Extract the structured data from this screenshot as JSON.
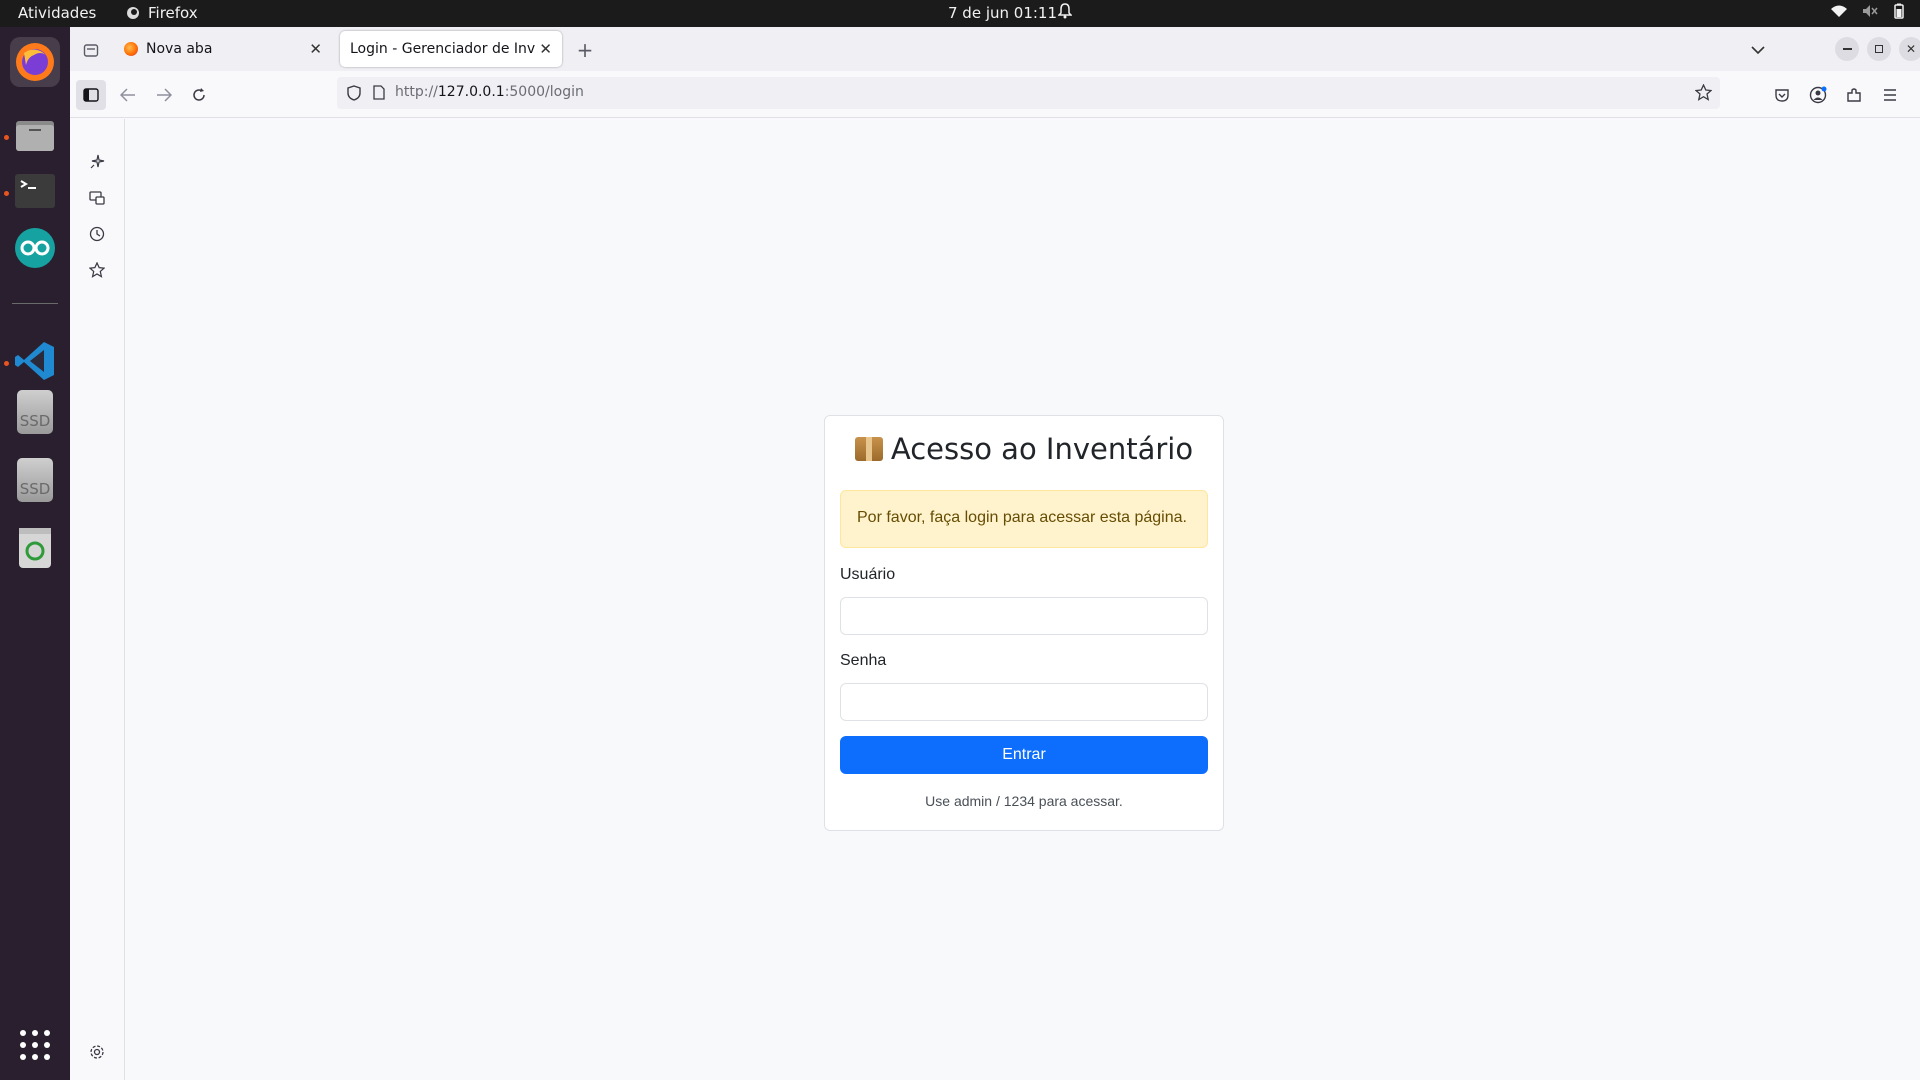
{
  "system_bar": {
    "activities": "Atividades",
    "app_name": "Firefox",
    "datetime": "7 de jun  01:11"
  },
  "dock": {
    "ssd1_label": "SSD",
    "ssd2_label": "SSD"
  },
  "browser": {
    "tabs": [
      {
        "title": "Nova aba"
      },
      {
        "title": "Login - Gerenciador de Inventário"
      }
    ],
    "url_prefix": "http://",
    "url_host": "127.0.0.1",
    "url_rest": ":5000/login"
  },
  "login": {
    "title": "Acesso ao Inventário",
    "alert": "Por favor, faça login para acessar esta página.",
    "username_label": "Usuário",
    "password_label": "Senha",
    "submit_label": "Entrar",
    "hint": "Use admin / 1234 para acessar."
  },
  "colors": {
    "primary": "#0d6efd",
    "alert_bg": "#fff3cd",
    "dock_bg": "#2a1f2e"
  }
}
